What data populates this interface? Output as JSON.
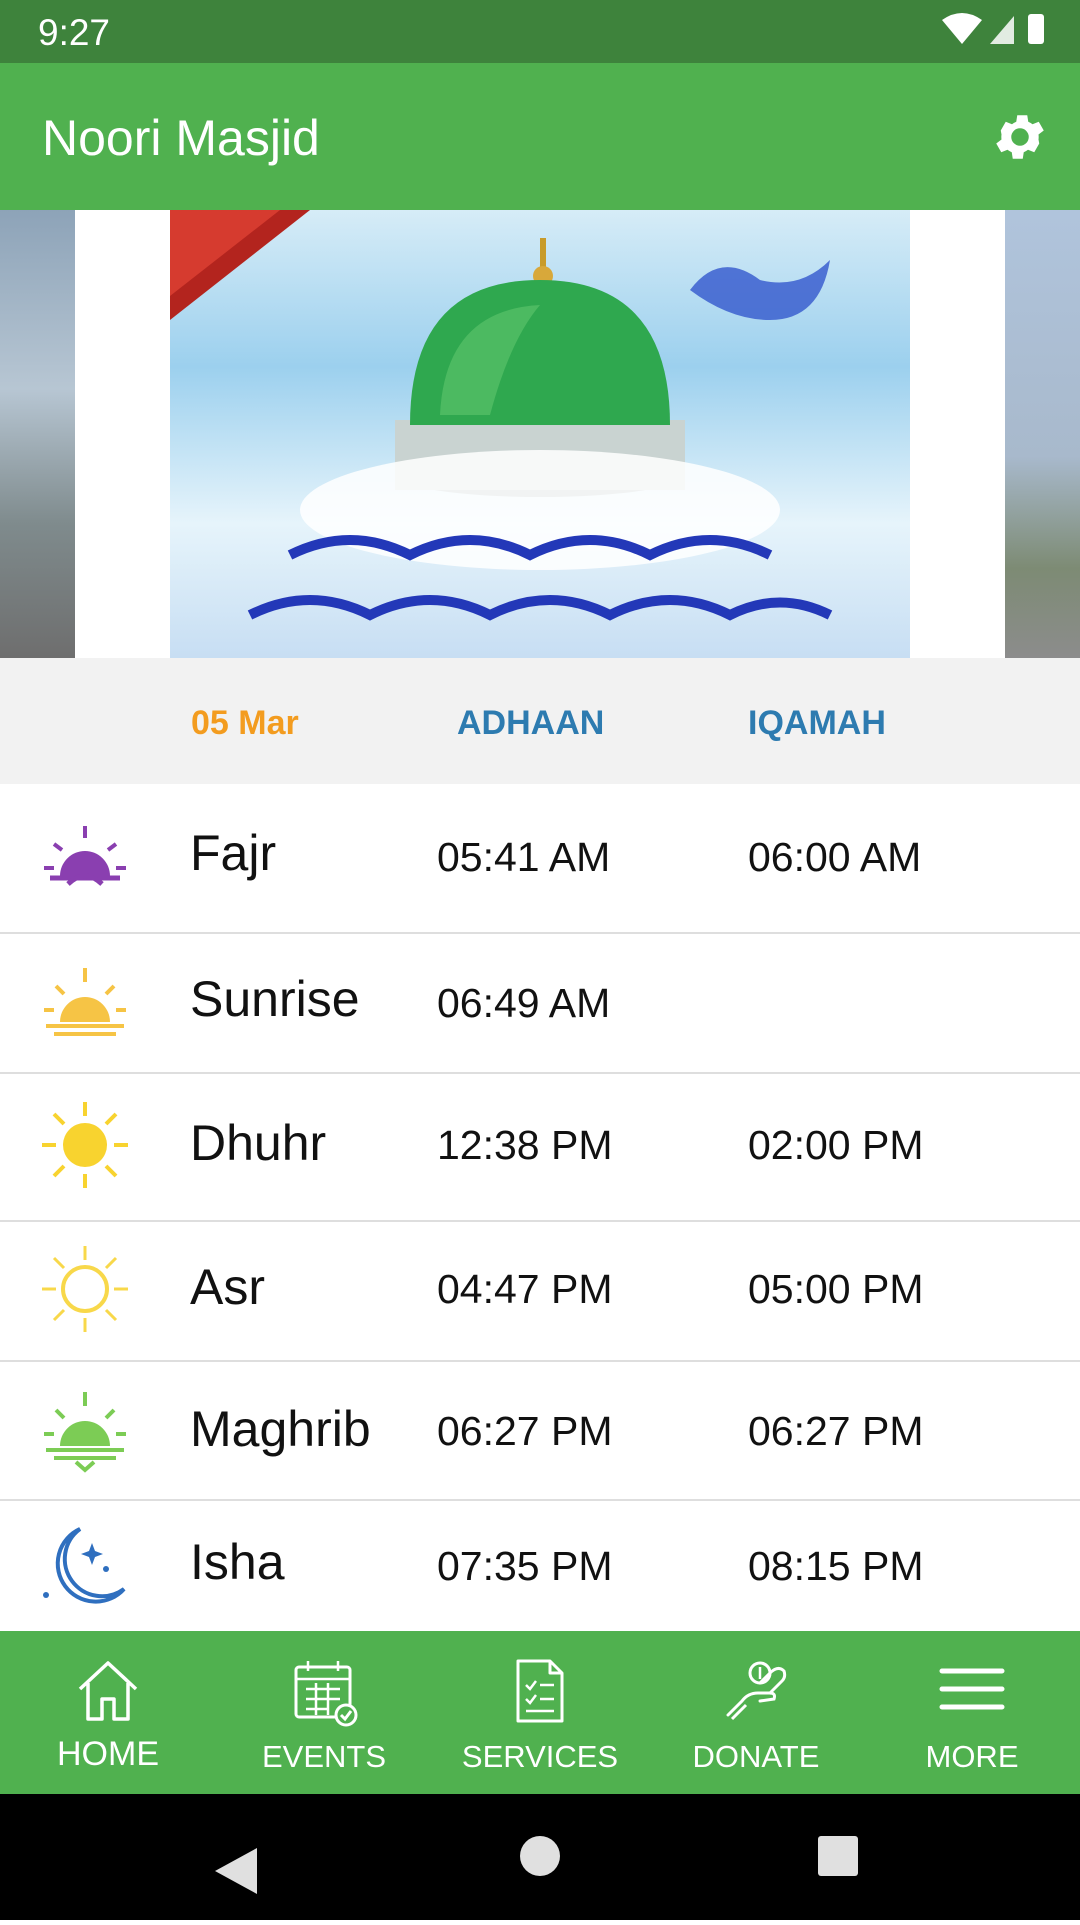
{
  "status_bar": {
    "time": "9:27"
  },
  "app_bar": {
    "title": "Noori Masjid"
  },
  "colors": {
    "primary": "#50b14f",
    "status_bar": "#3e833c",
    "date_header": "#f39c1f",
    "column_header": "#2d7bb0"
  },
  "table_header": {
    "date": "05 Mar",
    "adhaan": "ADHAAN",
    "iqamah": "IQAMAH"
  },
  "prayers": [
    {
      "name": "Fajr",
      "adhaan": "05:41 AM",
      "iqamah": "06:00 AM",
      "icon": "sunrise-half-sun-icon"
    },
    {
      "name": "Sunrise",
      "adhaan": "06:49 AM",
      "iqamah": "",
      "icon": "sunrise-icon"
    },
    {
      "name": "Dhuhr",
      "adhaan": "12:38 PM",
      "iqamah": "02:00 PM",
      "icon": "full-sun-icon"
    },
    {
      "name": "Asr",
      "adhaan": "04:47 PM",
      "iqamah": "05:00 PM",
      "icon": "outline-sun-icon"
    },
    {
      "name": "Maghrib",
      "adhaan": "06:27 PM",
      "iqamah": "06:27 PM",
      "icon": "sunset-icon"
    },
    {
      "name": "Isha",
      "adhaan": "07:35 PM",
      "iqamah": "08:15 PM",
      "icon": "moon-stars-icon"
    }
  ],
  "bottom_nav": [
    {
      "label": "HOME",
      "icon": "home-icon"
    },
    {
      "label": "EVENTS",
      "icon": "calendar-icon"
    },
    {
      "label": "SERVICES",
      "icon": "document-icon"
    },
    {
      "label": "DONATE",
      "icon": "donate-hand-icon"
    },
    {
      "label": "MORE",
      "icon": "menu-icon"
    }
  ]
}
